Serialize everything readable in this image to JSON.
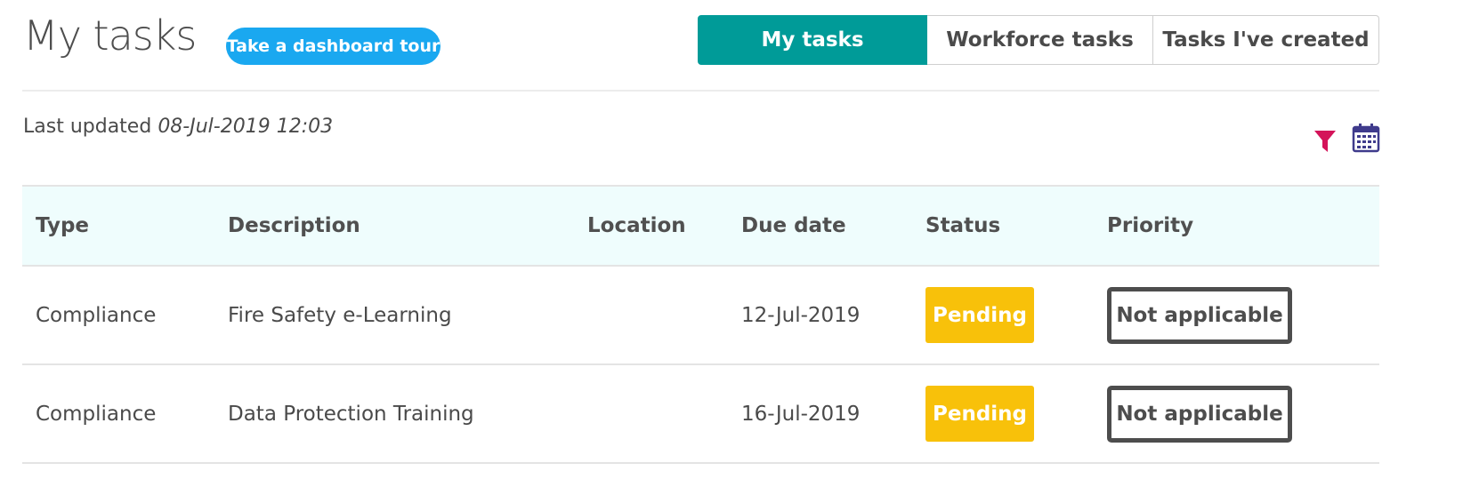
{
  "header": {
    "title": "My tasks",
    "tour_button": "Take a dashboard tour"
  },
  "tabs": [
    {
      "label": "My tasks",
      "active": true
    },
    {
      "label": "Workforce tasks",
      "active": false
    },
    {
      "label": "Tasks I've created",
      "active": false
    }
  ],
  "toolbar": {
    "updated_label": "Last updated",
    "updated_value": "08-Jul-2019 12:03",
    "filter_icon": "filter-icon",
    "calendar_icon": "calendar-icon"
  },
  "table": {
    "columns": [
      "Type",
      "Description",
      "Location",
      "Due date",
      "Status",
      "Priority"
    ],
    "rows": [
      {
        "type": "Compliance",
        "description": "Fire Safety e-Learning",
        "location": "",
        "due": "12-Jul-2019",
        "status": "Pending",
        "priority": "Not applicable"
      },
      {
        "type": "Compliance",
        "description": "Data Protection Training",
        "location": "",
        "due": "16-Jul-2019",
        "status": "Pending",
        "priority": "Not applicable"
      }
    ]
  },
  "colors": {
    "active_tab": "#009b98",
    "tour_button": "#1aa8f0",
    "pending": "#f8c10a",
    "filter_icon": "#d4145a",
    "calendar_icon": "#3f3b8c",
    "header_bg": "#effdfd"
  }
}
